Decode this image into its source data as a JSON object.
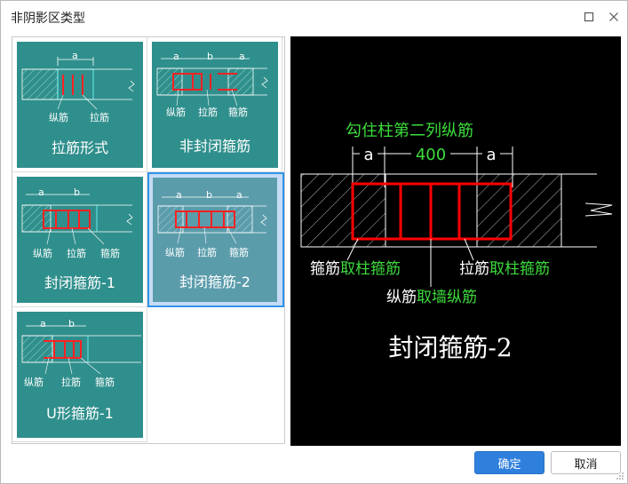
{
  "window": {
    "title": "非阴影区类型",
    "maximize_icon": "maximize-icon",
    "close_icon": "close-icon"
  },
  "gallery": {
    "items": [
      {
        "label": "拉筋形式",
        "dim": "a",
        "callouts": [
          "纵筋",
          "拉筋"
        ]
      },
      {
        "label": "非封闭箍筋",
        "dims": [
          "a",
          "b",
          "a"
        ],
        "callouts": [
          "纵筋",
          "拉筋",
          "箍筋"
        ]
      },
      {
        "label": "封闭箍筋-1",
        "dims": [
          "a",
          "b"
        ],
        "callouts": [
          "纵筋",
          "拉筋",
          "箍筋"
        ]
      },
      {
        "label": "封闭箍筋-2",
        "dims": [
          "a",
          "b",
          "a"
        ],
        "callouts": [
          "纵筋",
          "拉筋",
          "箍筋"
        ],
        "selected": true
      },
      {
        "label": "U形箍筋-1",
        "dims": [
          "a",
          "b"
        ],
        "callouts": [
          "纵筋",
          "拉筋",
          "箍筋"
        ]
      }
    ]
  },
  "preview": {
    "header": "勾住柱第二列纵筋",
    "dim_left": "a",
    "dim_mid": "400",
    "dim_right": "a",
    "left_callout_white": "箍筋",
    "left_callout_green": "取柱箍筋",
    "right_callout_white": "拉筋",
    "right_callout_green": "取柱箍筋",
    "bottom_callout_white": "纵筋",
    "bottom_callout_green": "取墙纵筋",
    "title": "封闭箍筋-2"
  },
  "buttons": {
    "ok": "确定",
    "cancel": "取消"
  },
  "colors": {
    "accent": "#2f7fdd",
    "card": "#2f8f8c",
    "selection": "#2f94ec",
    "rebar": "#ff0000",
    "annotation_green": "#3ddc3d"
  }
}
